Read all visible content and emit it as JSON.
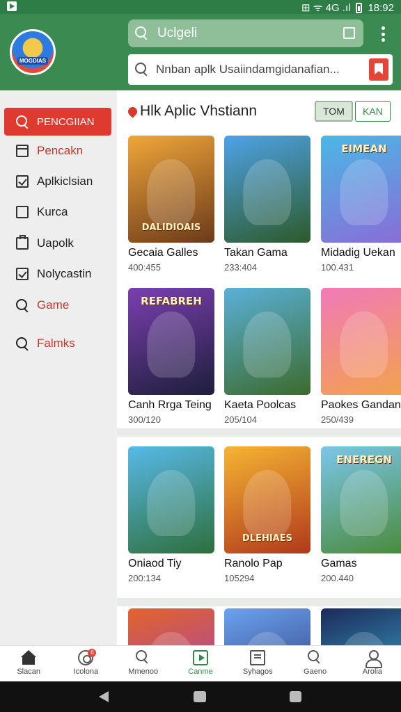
{
  "status_bar": {
    "icons": "⊞ ᯤ 4G .ıl",
    "time": "18:92"
  },
  "header": {
    "logo_text": "MOGDIAS",
    "top_search_text": "Uclgeli",
    "search_placeholder": "Nnban aplk Usaiindamgidanafian..."
  },
  "sidebar": {
    "items": [
      {
        "label": "PENCGIIAN",
        "icon": "search-icon"
      },
      {
        "label": "Pencakn",
        "icon": "window-icon"
      },
      {
        "label": "Aplkiclsian",
        "icon": "checkbox-icon"
      },
      {
        "label": "Kurca",
        "icon": "square-icon"
      },
      {
        "label": "Uapolk",
        "icon": "folder-icon"
      },
      {
        "label": "Nolycastin",
        "icon": "checked-box-icon"
      },
      {
        "label": "Game",
        "icon": "search-icon"
      },
      {
        "label": "Falmks",
        "icon": "search-icon"
      }
    ]
  },
  "content": {
    "section_title": "Hlk Aplic Vhstiann",
    "filter_1": "TOM",
    "filter_2": "KAN",
    "games": [
      {
        "name": "Gecaia Galles",
        "count": "400:455",
        "badge": "DALIDIOAIS",
        "banner": "",
        "colors": [
          "#f0a63a",
          "#6b3a1a"
        ]
      },
      {
        "name": "Takan Gama",
        "count": "233:404",
        "badge": "",
        "banner": "",
        "colors": [
          "#4ea3e8",
          "#2d5a2a"
        ]
      },
      {
        "name": "Midadig Uekan",
        "count": "100.431",
        "badge": "",
        "banner": "EIMEAN",
        "colors": [
          "#4bb7e6",
          "#8a6cd6"
        ]
      },
      {
        "name": "Canh Rrga Teing",
        "count": "300/120",
        "badge": "",
        "banner": "REFABREH",
        "colors": [
          "#7b3fb0",
          "#1d1f3a"
        ]
      },
      {
        "name": "Kaeta Poolcas",
        "count": "205/104",
        "badge": "",
        "banner": "",
        "colors": [
          "#5ab0d8",
          "#3c6b2c"
        ]
      },
      {
        "name": "Paokes Gandan",
        "count": "250/439",
        "badge": "",
        "banner": "",
        "colors": [
          "#f07ab8",
          "#f3a24c"
        ]
      },
      {
        "name": "Oniaod Tiy",
        "count": "200:134",
        "badge": "",
        "banner": "",
        "colors": [
          "#58b9e8",
          "#2d6f3b"
        ]
      },
      {
        "name": "Ranolo Pap",
        "count": "105294",
        "badge": "DLEHIAES",
        "banner": "",
        "colors": [
          "#f5b533",
          "#b0391c"
        ]
      },
      {
        "name": "Gamas",
        "count": "200.440",
        "badge": "",
        "banner": "ENEREGN",
        "colors": [
          "#7bc6ea",
          "#4a8a3a"
        ]
      },
      {
        "name": "",
        "count": "",
        "badge": "",
        "banner": "",
        "colors": [
          "#e2642b",
          "#9a3fbf"
        ]
      },
      {
        "name": "",
        "count": "",
        "badge": "",
        "banner": "",
        "colors": [
          "#6aa3f0",
          "#2a2f6a"
        ]
      },
      {
        "name": "",
        "count": "",
        "badge": "",
        "banner": "",
        "colors": [
          "#1c2a5a",
          "#3ec0e0"
        ]
      }
    ]
  },
  "bottom_nav": {
    "items": [
      {
        "label": "Slacan",
        "icon": "home-icon"
      },
      {
        "label": "Icolona",
        "icon": "ring-icon",
        "badge": "6"
      },
      {
        "label": "Mmenoo",
        "icon": "search-icon"
      },
      {
        "label": "Canme",
        "icon": "play-icon",
        "active": true
      },
      {
        "label": "Syhagos",
        "icon": "cart-icon"
      },
      {
        "label": "Gaeno",
        "icon": "search-icon"
      },
      {
        "label": "Arolia",
        "icon": "person-icon"
      }
    ]
  },
  "colors": {
    "brand_green": "#3b8a51",
    "accent_red": "#de3a2f"
  }
}
